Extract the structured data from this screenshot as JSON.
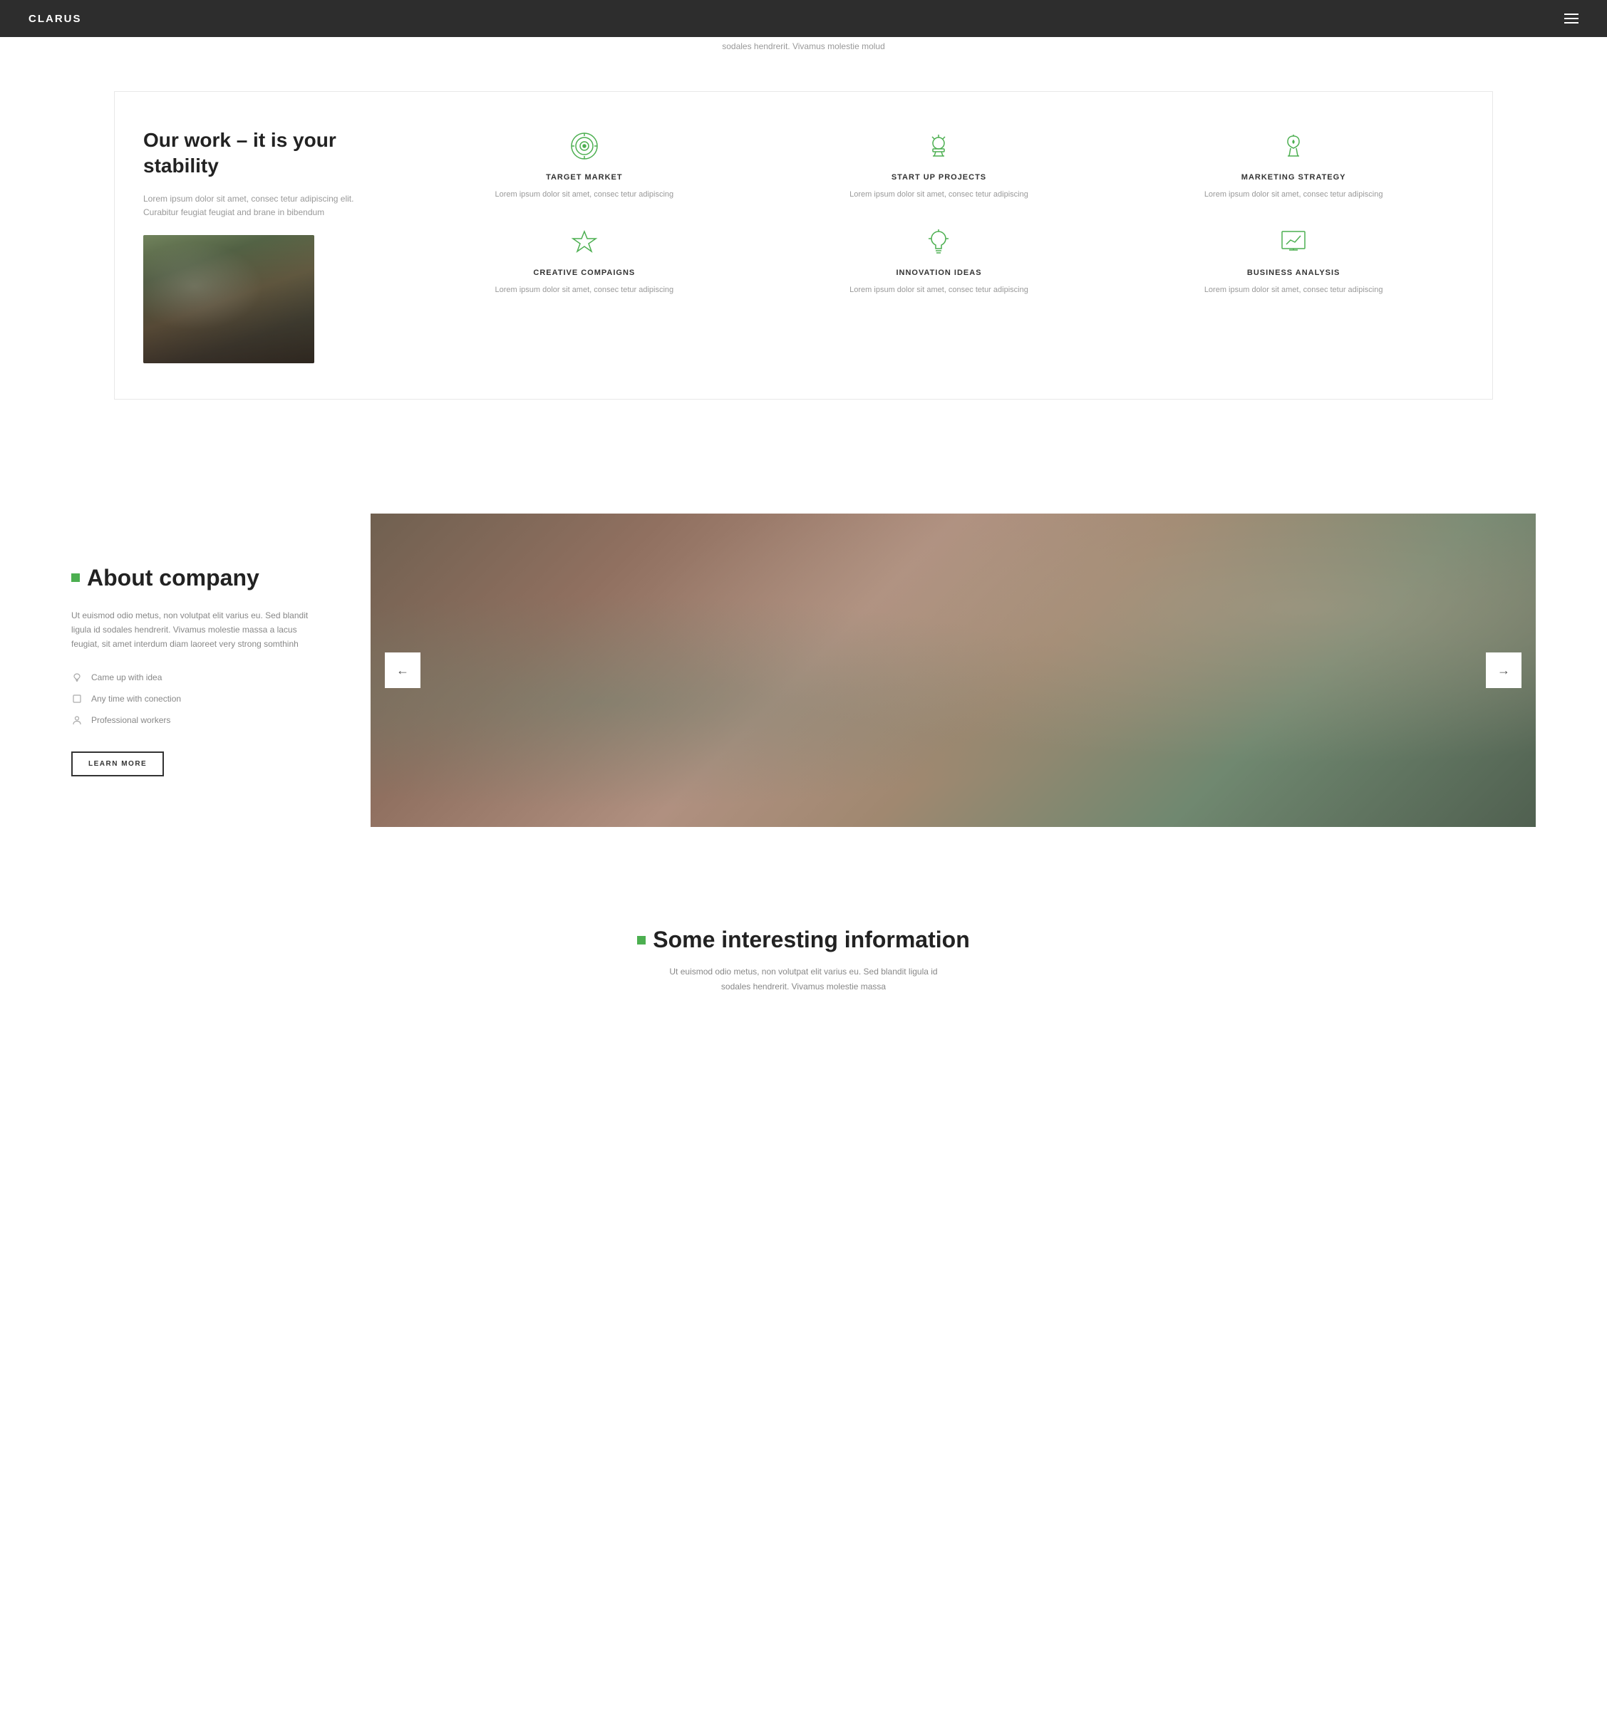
{
  "navbar": {
    "logo": "CLARUS",
    "menu_icon_label": "menu"
  },
  "top_text": "sodales hendrerit. Vivamus molestie molud",
  "our_work": {
    "title": "Our work – it is your stability",
    "description": "Lorem ipsum dolor sit amet, consec tetur adipiscing elit. Curabitur feugiat feugiat and brane in bibendum",
    "features": [
      {
        "id": "target-market",
        "title": "TARGET MARKET",
        "description": "Lorem ipsum dolor sit amet, consec tetur adipiscing",
        "icon": "target"
      },
      {
        "id": "start-up-projects",
        "title": "START UP PROJECTS",
        "description": "Lorem ipsum dolor sit amet, consec tetur adipiscing",
        "icon": "telescope"
      },
      {
        "id": "marketing-strategy",
        "title": "MARKETING STRATEGY",
        "description": "Lorem ipsum dolor sit amet, consec tetur adipiscing",
        "icon": "horse"
      },
      {
        "id": "creative-campaigns",
        "title": "CREATIVE COMPAIGNS",
        "description": "Lorem ipsum dolor sit amet, consec tetur adipiscing",
        "icon": "trophy"
      },
      {
        "id": "innovation-ideas",
        "title": "INNOVATION IDEAS",
        "description": "Lorem ipsum dolor sit amet, consec tetur adipiscing",
        "icon": "lightbulb"
      },
      {
        "id": "business-analysis",
        "title": "BUSINESS ANALYSIS",
        "description": "Lorem ipsum dolor sit amet, consec tetur adipiscing",
        "icon": "chart"
      }
    ]
  },
  "about": {
    "title": "About company",
    "description": "Ut euismod odio metus, non volutpat elit varius eu. Sed blandit ligula id sodales hendrerit. Vivamus molestie massa a lacus feugiat, sit amet interdum diam laoreet very strong somthinh",
    "list_items": [
      {
        "text": "Came up with idea",
        "icon": "lightbulb-small"
      },
      {
        "text": "Any time with conection",
        "icon": "square"
      },
      {
        "text": "Professional workers",
        "icon": "person"
      }
    ],
    "learn_more_label": "LEARN MORE",
    "slider_prev": "←",
    "slider_next": "→"
  },
  "info": {
    "title": "Some interesting information",
    "description": "Ut euismod odio metus, non volutpat elit varius eu. Sed blandit ligula id sodales hendrerit. Vivamus molestie massa"
  }
}
